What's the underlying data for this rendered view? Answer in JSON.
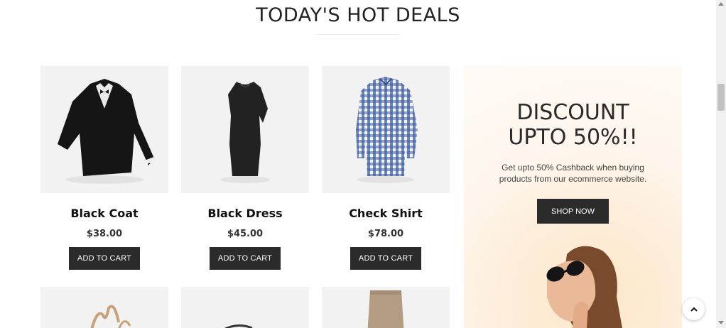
{
  "section": {
    "title": "TODAY'S HOT DEALS"
  },
  "products": [
    {
      "name": "Black Coat",
      "price": "$38.00",
      "cart_label": "ADD TO CART",
      "icon": "black-coat-image"
    },
    {
      "name": "Black Dress",
      "price": "$45.00",
      "cart_label": "ADD TO CART",
      "icon": "black-dress-image"
    },
    {
      "name": "Check Shirt",
      "price": "$78.00",
      "cart_label": "ADD TO CART",
      "icon": "check-shirt-image"
    }
  ],
  "promo": {
    "headline_line1": "DISCOUNT",
    "headline_line2": "UPTO 50%!!",
    "subtitle": "Get upto 50% Cashback when buying products from our ecommerce website.",
    "button_label": "SHOP NOW"
  },
  "colors": {
    "button_bg": "#2b2b2b",
    "card_bg": "#f2f2f2",
    "promo_bg": "#fdeedb"
  }
}
